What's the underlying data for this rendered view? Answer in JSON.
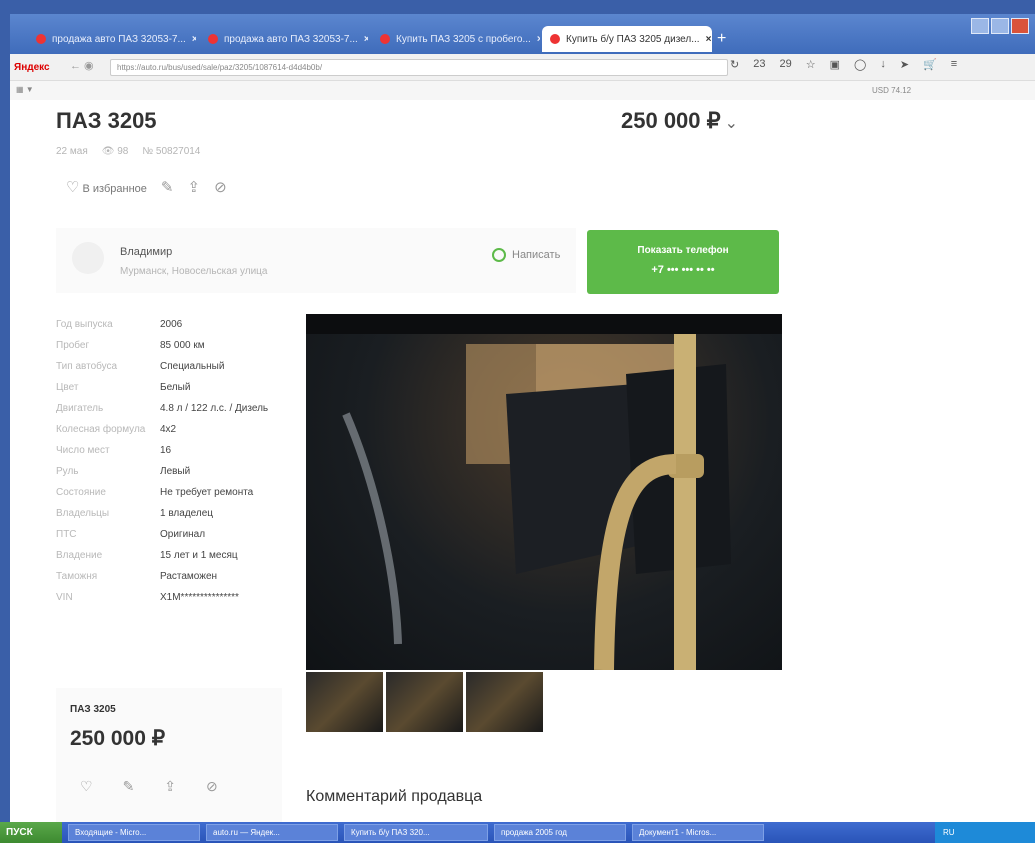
{
  "browser": {
    "tabs": [
      {
        "label": "продажа авто ПАЗ 32053-7..."
      },
      {
        "label": "продажа авто ПАЗ 32053-7..."
      },
      {
        "label": "Купить ПАЗ 3205 с пробего..."
      },
      {
        "label": "Купить б/у ПАЗ 3205 дизел..."
      }
    ],
    "logo": "Яндекс",
    "url": "https://auto.ru/bus/used/sale/paz/3205/1087614-d4d4b0b/",
    "toolbar_counters": [
      "23",
      "29"
    ],
    "currency": "USD 74.12"
  },
  "listing": {
    "title": "ПАЗ 3205",
    "price": "250 000 ₽",
    "meta": {
      "date": "22 мая",
      "views": "98",
      "number": "№ 50827014"
    },
    "favorite_label": "В избранное",
    "seller": {
      "name": "Владимир",
      "address": "Мурманск, Новосельская улица"
    },
    "write_label": "Написать",
    "phone_button": {
      "label": "Показать телефон",
      "number": "+7 ••• ••• •• ••"
    },
    "specs": [
      {
        "k": "Год выпуска",
        "v": "2006"
      },
      {
        "k": "Пробег",
        "v": "85 000 км"
      },
      {
        "k": "Тип автобуса",
        "v": "Специальный"
      },
      {
        "k": "Цвет",
        "v": "Белый"
      },
      {
        "k": "Двигатель",
        "v": "4.8 л / 122 л.с. / Дизель"
      },
      {
        "k": "Колесная формула",
        "v": "4x2"
      },
      {
        "k": "Число мест",
        "v": "16"
      },
      {
        "k": "Руль",
        "v": "Левый"
      },
      {
        "k": "Состояние",
        "v": "Не требует ремонта"
      },
      {
        "k": "Владельцы",
        "v": "1 владелец"
      },
      {
        "k": "ПТС",
        "v": "Оригинал"
      },
      {
        "k": "Владение",
        "v": "15 лет и 1 месяц"
      },
      {
        "k": "Таможня",
        "v": "Растаможен"
      },
      {
        "k": "VIN",
        "v": "X1M***************"
      }
    ],
    "card": {
      "name": "ПАЗ 3205",
      "price": "250 000 ₽"
    },
    "comments_title": "Комментарий продавца"
  },
  "taskbar": {
    "start": "ПУСК",
    "items": [
      "Входящие - Micro...",
      "auto.ru — Яндек...",
      "Купить б/у ПАЗ 320...",
      "продажа 2005 год",
      "Документ1 - Micros..."
    ],
    "tray": "RU"
  }
}
